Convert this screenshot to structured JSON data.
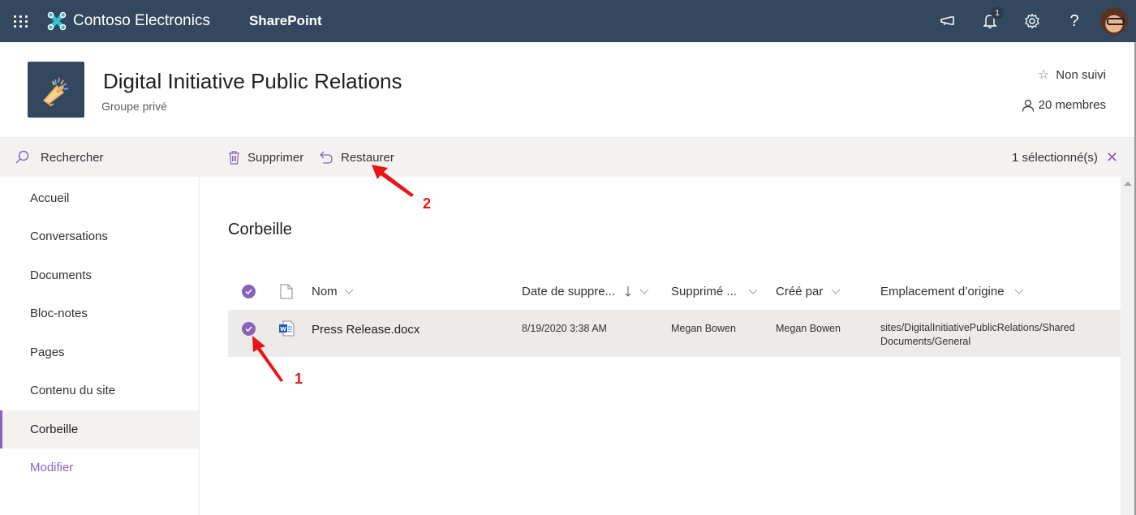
{
  "suitebar": {
    "app_launcher_icon": "waffle-icon",
    "brand": "Contoso Electronics",
    "app_name": "SharePoint",
    "icons": [
      "megaphone-icon",
      "bell-icon",
      "gear-icon",
      "help-icon"
    ],
    "notification_count": "1",
    "help_label": "?",
    "avatar": "user-avatar"
  },
  "site": {
    "title": "Digital Initiative Public Relations",
    "subtitle": "Groupe privé",
    "follow_label": "Non suivi",
    "members_label": "20 membres"
  },
  "search": {
    "label": "Rechercher"
  },
  "commands": {
    "delete_label": "Supprimer",
    "restore_label": "Restaurer",
    "selected_label": "1 sélectionné(s)"
  },
  "nav": {
    "items": [
      {
        "label": "Accueil"
      },
      {
        "label": "Conversations"
      },
      {
        "label": "Documents"
      },
      {
        "label": "Bloc-notes"
      },
      {
        "label": "Pages"
      },
      {
        "label": "Contenu du site"
      },
      {
        "label": "Corbeille",
        "active": true
      }
    ],
    "edit_label": "Modifier"
  },
  "main": {
    "heading": "Corbeille",
    "columns": {
      "name": "Nom",
      "deleted_date": "Date de suppre...",
      "deleted_by": "Supprimé ...",
      "created_by": "Créé par",
      "original_location": "Emplacement d’origine"
    },
    "rows": [
      {
        "selected": true,
        "file_type": "word-document",
        "name": "Press Release.docx",
        "deleted_date": "8/19/2020 3:38 AM",
        "deleted_by": "Megan Bowen",
        "created_by": "Megan Bowen",
        "original_location_line1": "sites/DigitalInitiativePublicRelations/Shared",
        "original_location_line2": "Documents/General"
      }
    ]
  },
  "annotations": {
    "step1": "1",
    "step2": "2"
  },
  "colors": {
    "suitebar": "#33485f",
    "accent": "#8764b8",
    "annotation": "#e8141a",
    "selected_row": "#edebe9"
  }
}
